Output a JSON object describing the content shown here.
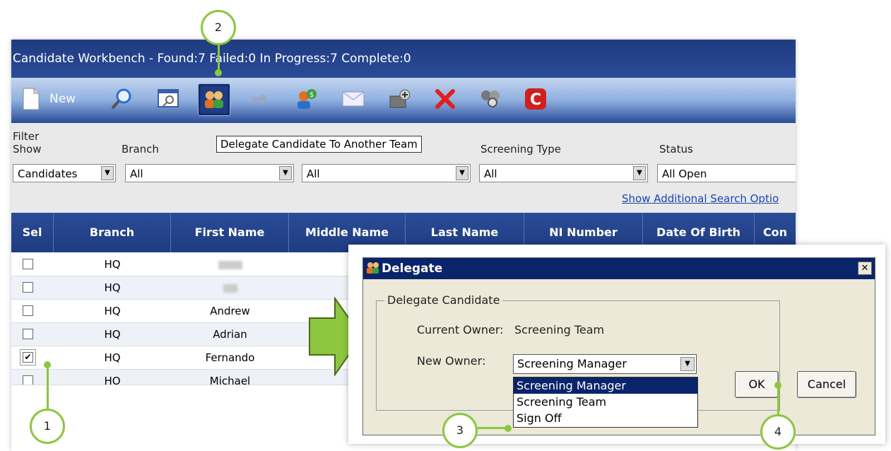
{
  "window": {
    "title": "Candidate Workbench - Found:7 Failed:0 In Progress:7 Complete:0"
  },
  "toolbar": {
    "new_label": "New",
    "tooltip": "Delegate Candidate To Another Team"
  },
  "filter": {
    "group_label": "Filter",
    "show_label": "Show",
    "branch_label": "Branch",
    "screening_type_label": "Screening Type",
    "status_label": "Status",
    "show_value": "Candidates",
    "branch_value": "All",
    "third_value": "All",
    "screening_type_value": "All",
    "status_value": "All Open",
    "additional_options_link": "Show Additional Search Optio"
  },
  "table": {
    "columns": [
      "Sel",
      "Branch",
      "First Name",
      "Middle Name",
      "Last Name",
      "NI Number",
      "Date Of Birth",
      "Con"
    ],
    "rows": [
      {
        "branch": "HQ",
        "first_name": "",
        "checked": false
      },
      {
        "branch": "HQ",
        "first_name": "",
        "checked": false
      },
      {
        "branch": "HQ",
        "first_name": "Andrew",
        "checked": false
      },
      {
        "branch": "HQ",
        "first_name": "Adrian",
        "checked": false
      },
      {
        "branch": "HQ",
        "first_name": "Fernando",
        "checked": true
      },
      {
        "branch": "HO",
        "first_name": "Michael",
        "checked": false
      }
    ]
  },
  "dialog": {
    "title": "Delegate",
    "close_glyph": "✕",
    "group_label": "Delegate Candidate",
    "current_owner_label": "Current Owner:",
    "current_owner_value": "Screening Team",
    "new_owner_label": "New Owner:",
    "new_owner_value": "Screening Manager",
    "options": [
      "Screening Manager",
      "Screening Team",
      "Sign Off"
    ],
    "ok_label": "OK",
    "cancel_label": "Cancel"
  },
  "callouts": [
    "1",
    "2",
    "3",
    "4"
  ],
  "colors": {
    "accent_green": "#8dc63f",
    "title_blue": "#1f3b80",
    "dialog_title_blue": "#0a246a",
    "link_blue": "#1a44b0"
  }
}
